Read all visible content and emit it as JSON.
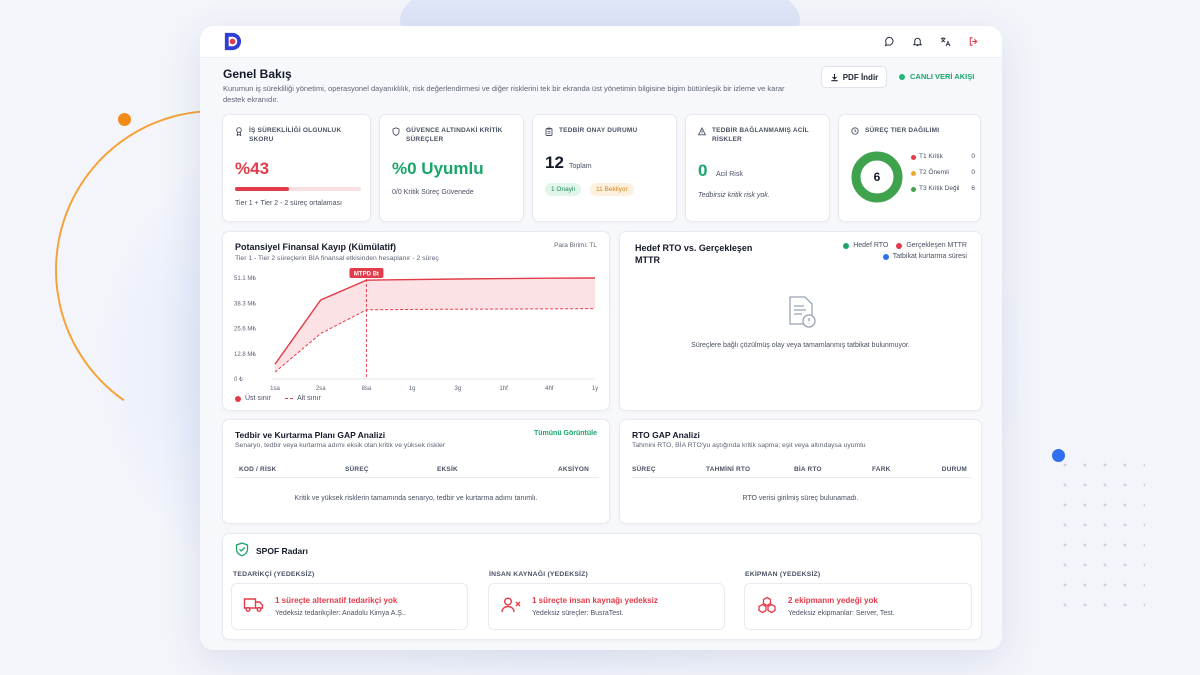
{
  "header": {
    "title": "Genel Bakış",
    "subtitle": "Kurumun iş sürekliliği yönetimi, operasyonel dayanıklılık, risk değerlendirmesi ve diğer risklerini tek bir ekranda üst yönetimin bilgisine bigim bütünleşik bir izleme ve karar destek ekranıdır.",
    "pdf_label": "PDF İndir",
    "live_label": "CANLI VERİ AKIŞI"
  },
  "kpis": {
    "continuity": {
      "title": "İŞ SÜREKLİLİĞİ OLGUNLUK SKORU",
      "value": "%43",
      "progress": 0.43,
      "note": "Tier 1 + Tier 2 - 2 süreç ortalaması"
    },
    "assurance": {
      "title": "GÜVENCE ALTINDAKİ KRİTİK SÜREÇLER",
      "value": "%0 Uyumlu",
      "note": "0/0 Kritik Süreç Güvenede"
    },
    "approval": {
      "title": "TEDBİR ONAY DURUMU",
      "count": "12",
      "count_label": "Toplam",
      "approved": "1 Onaylı",
      "waiting": "11 Bekliyor"
    },
    "unlinked": {
      "title": "TEDBİR BAĞLANMAMIŞ ACİL RİSKLER",
      "count": "0",
      "count_label": "Acil Risk",
      "note": "Tedbirsiz kritik risk yok."
    },
    "tiers": {
      "title": "SÜREÇ TIER DAĞILIMI",
      "total": "6",
      "items": [
        {
          "name": "T1 Kritik",
          "value": "0",
          "color": "#e23c4a"
        },
        {
          "name": "T2 Önemli",
          "value": "0",
          "color": "#f0a92a"
        },
        {
          "name": "T3 Kritik Değil",
          "value": "6",
          "color": "#3fa34d"
        }
      ]
    }
  },
  "finance": {
    "title": "Potansiyel Finansal Kayıp (Kümülatif)",
    "subtitle": "Tier 1 - Tier 2 süreçlerin BİA finansal etkisinden hesaplanır - 2 süreç",
    "currency": "Para Birimi: TL",
    "marker_label": "MTPD Bt",
    "legend_upper": "Üst sınır",
    "legend_lower": "Alt sınır",
    "colors": {
      "upper": "#e23c4a",
      "band": "#fbdde0"
    }
  },
  "rto_chart": {
    "title": "Hedef RTO vs. Gerçekleşen MTTR",
    "legend": [
      {
        "name": "Hedef RTO",
        "color": "#1aa56a"
      },
      {
        "name": "Gerçekleşen MTTR",
        "color": "#e23c4a"
      },
      {
        "name": "Tatbikat kurtarma süresi",
        "color": "#2f6ff0"
      }
    ],
    "empty": "Süreçlere bağlı çözülmüş olay veya tamamlanmış tatbikat bulunmuyor."
  },
  "gap_table": {
    "title": "Tedbir ve Kurtarma Planı GAP Analizi",
    "subtitle": "Senaryo, tedbir veya kurtarma adımı eksik olan kritik ve yüksek riskler",
    "link": "Tümünü Görüntüle",
    "columns": [
      "KOD / RİSK",
      "SÜREÇ",
      "EKSİK",
      "AKSİYON"
    ],
    "empty": "Kritik ve yüksek risklerin tamamında senaryo, tedbir ve kurtarma adımı tanımlı."
  },
  "rto_table": {
    "title": "RTO GAP Analizi",
    "subtitle": "Tahmini RTO, BİA RTO'yu aştığında kritik sapma; eşit veya altındaysa uyumlu",
    "columns": [
      "SÜREÇ",
      "TAHMİNİ RTO",
      "BİA RTO",
      "FARK",
      "DURUM"
    ],
    "empty": "RTO verisi girilmiş süreç bulunamadı."
  },
  "spof": {
    "title": "SPOF Radarı",
    "columns": [
      {
        "label": "TEDARİKÇİ (YEDEKSİZ)",
        "headline": "1 süreçte alternatif tedarikçi yok",
        "detail": "Yedeksiz tedarikçiler: Anadolu Kimya A.Ş..",
        "icon": "truck-icon"
      },
      {
        "label": "İNSAN KAYNAĞI (YEDEKSİZ)",
        "headline": "1 süreçte insan kaynağı yedeksiz",
        "detail": "Yedeksiz süreçler: BusraTest.",
        "icon": "user-x-icon"
      },
      {
        "label": "EKİPMAN (YEDEKSİZ)",
        "headline": "2 ekipmanın yedeği yok",
        "detail": "Yedeksiz ekipmanlar: Server, Test.",
        "icon": "boxes-icon"
      }
    ]
  },
  "chart_data": {
    "type": "area",
    "title": "Potansiyel Finansal Kayıp (Kümülatif)",
    "x": [
      "1sa",
      "2sa",
      "8sa",
      "1g",
      "3g",
      "1hf",
      "4hf",
      "1y"
    ],
    "y_ticks": [
      "0 ₺",
      "12.8 M₺",
      "25.6 M₺",
      "38.3 M₺",
      "51.1 M₺"
    ],
    "ylim": [
      0,
      51.1
    ],
    "series": [
      {
        "name": "Üst sınır",
        "values": [
          7.5,
          40,
          50,
          50.3,
          50.6,
          50.8,
          51,
          51.1
        ]
      },
      {
        "name": "Alt sınır",
        "values": [
          3.5,
          23,
          35,
          35.2,
          35.3,
          35.4,
          35.5,
          35.6
        ]
      }
    ],
    "marker": {
      "x": "8sa",
      "label": "MTPD Bt"
    },
    "grid": false
  }
}
